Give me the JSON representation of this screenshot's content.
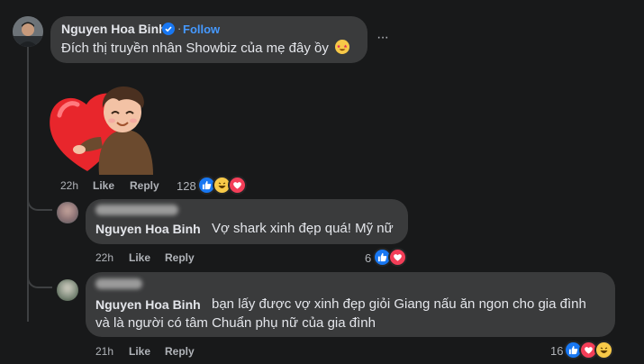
{
  "comment1": {
    "author": "Nguyen Hoa Binh",
    "follow_label": "Follow",
    "text": "Đích thị truyền nhân Showbiz của mẹ đây ồy",
    "more": "···",
    "time": "22h",
    "like": "Like",
    "reply": "Reply",
    "reaction_count": "128",
    "reactions": [
      "like-icon",
      "laugh-icon",
      "love-icon"
    ]
  },
  "reply1": {
    "author": "Nguyen Hoa Binh",
    "text": "Vợ shark xinh đẹp quá! Mỹ nữ",
    "time": "22h",
    "like": "Like",
    "reply": "Reply",
    "reaction_count": "6",
    "reactions": [
      "like-icon",
      "love-icon"
    ]
  },
  "reply2": {
    "author": "Nguyen Hoa Binh",
    "text_line1": "bạn lấy được vợ xinh đẹp giỏi Giang nấu ăn ngon cho gia đình",
    "text_line2": "và là người có tâm Chuẩn phụ nữ của gia đình",
    "time": "21h",
    "like": "Like",
    "reply": "Reply",
    "reaction_count": "16",
    "reactions": [
      "like-icon",
      "love-icon",
      "laugh-icon"
    ]
  },
  "colors": {
    "background": "#18191a",
    "bubble": "#3a3b3c",
    "link": "#4599ff",
    "like": "#1877f2",
    "love": "#f33e58"
  }
}
